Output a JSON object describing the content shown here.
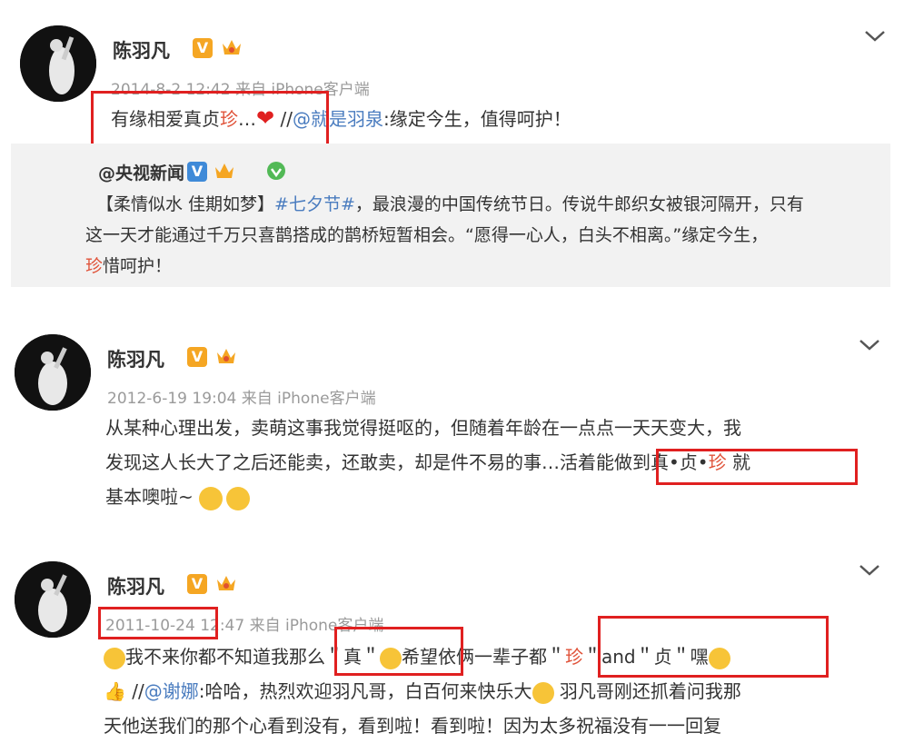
{
  "post1": {
    "name": "陈羽凡",
    "timestamp": "2014-8-2 12:42",
    "source": "来自 iPhone客户端",
    "text_a": "有缘相爱真贞",
    "text_red": "珍",
    "text_b": "…",
    "slash": " //",
    "mention": "@就是羽泉",
    "text_c": ":缘定今生，值得呵护！",
    "repost": {
      "name": "@央视新闻",
      "line1_a": "【柔情似水 佳期如梦】",
      "hashtag": "#七夕节#",
      "line1_b": "，最浪漫的中国传统节日。传说牛郎织女被银河隔开，只有",
      "line2": "这一天才能通过千万只喜鹊搭成的鹊桥短暂相会。“愿得一心人，白头不相离。”缘定今生，",
      "line3_red": "珍",
      "line3": "惜呵护！"
    }
  },
  "post2": {
    "name": "陈羽凡",
    "timestamp": "2012-6-19 19:04",
    "source": "来自 iPhone客户端",
    "line1": "从某种心理出发，卖萌这事我觉得挺呕的，但随着年龄在一点点一天天变大，我",
    "line2_a": "发现这人长大了之后还能卖，还敢卖，却是件不易的事…",
    "line2_b": "活着能做到真•贞•",
    "line2_red": "珍",
    "line2_c": " 就",
    "line3": "基本噢啦~"
  },
  "post3": {
    "name": "陈羽凡",
    "timestamp": "2011-10-24 12:47",
    "source": "来自 iPhone客户端",
    "line1_a": "我不来你都不知道我那么",
    "line1_q1": "＂真＂",
    "line1_b": "希望依俩一辈子都",
    "line1_c": "＂",
    "line1_red": "珍",
    "line1_d": "＂and＂贞＂嘿",
    "line2_a": " //",
    "line2_mention": "@谢娜",
    "line2_b": ":哈哈，热烈欢迎羽凡哥，白百何来快乐大",
    "line2_c": " 羽凡哥刚还抓着问我那",
    "line3": "天他送我们的那个心看到没有，看到啦！看到啦！因为太多祝福没有一一回复"
  },
  "colors": {
    "red_box": "#e02020",
    "link": "#4a7cbf",
    "badge": "#f5a623",
    "repost_bg": "#f2f2f2"
  },
  "icons": [
    "verified-v-icon",
    "crown-icon",
    "chevron-down-icon",
    "heart-icon",
    "emoji-icon"
  ]
}
